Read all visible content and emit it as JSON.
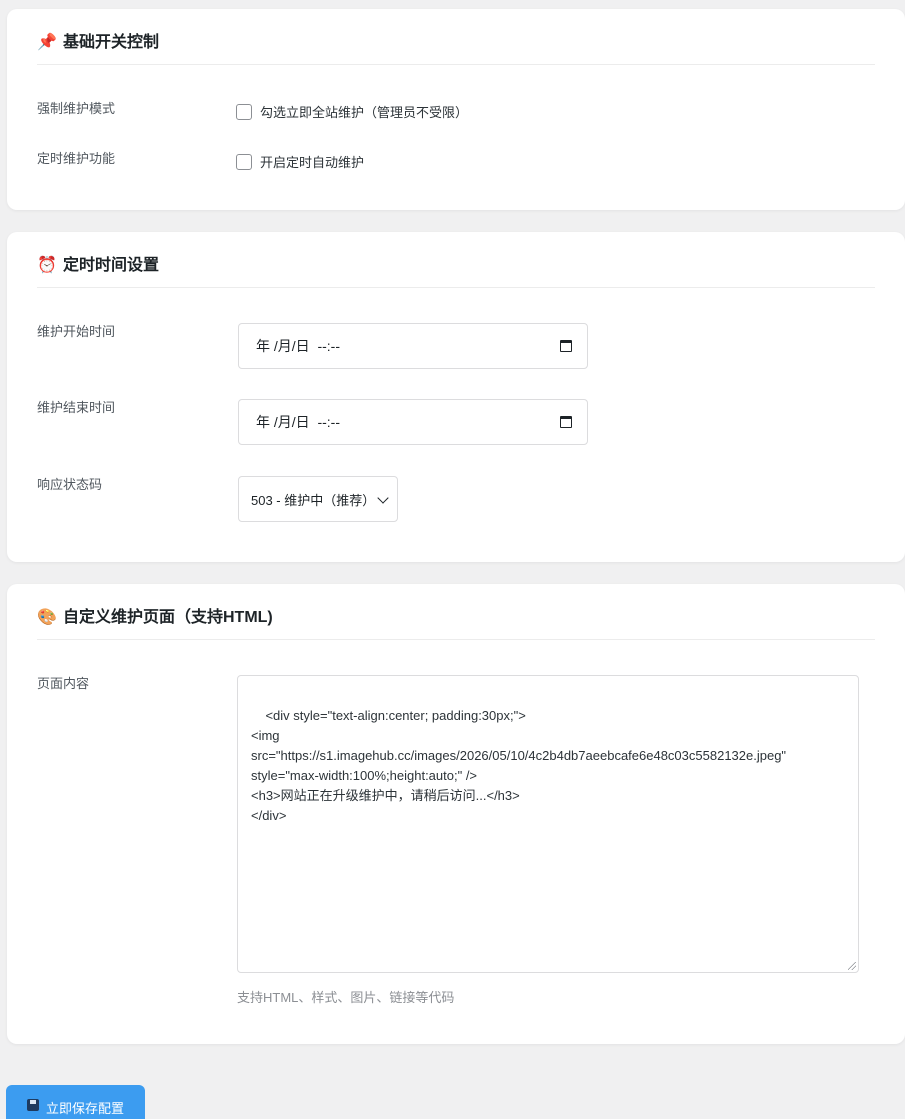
{
  "section_switch": {
    "icon": "pushpin-icon",
    "icon_glyph": "📌",
    "title": "基础开关控制",
    "force_maintenance": {
      "label": "强制维护模式",
      "checkbox_text": "勾选立即全站维护（管理员不受限）",
      "checked": false
    },
    "scheduled_maintenance": {
      "label": "定时维护功能",
      "checkbox_text": "开启定时自动维护",
      "checked": false
    }
  },
  "section_schedule": {
    "icon": "alarm-clock-icon",
    "icon_glyph": "⏰",
    "title": "定时时间设置",
    "start_time": {
      "label": "维护开始时间",
      "value": "年 /月/日  --:--"
    },
    "end_time": {
      "label": "维护结束时间",
      "value": "年 /月/日  --:--"
    },
    "status_code": {
      "label": "响应状态码",
      "selected": "503 - 维护中（推荐）"
    }
  },
  "section_custom": {
    "icon": "palette-icon",
    "icon_glyph": "🎨",
    "title": "自定义维护页面（支持HTML)",
    "content_label": "页面内容",
    "content_value": "<div style=\"text-align:center; padding:30px;\">\n<img\nsrc=\"https://s1.imagehub.cc/images/2026/05/10/4c2b4db7aeebcafe6e48c03c5582132e.jpeg\"\nstyle=\"max-width:100%;height:auto;\" />\n<h3>网站正在升级维护中，请稍后访问...</h3>\n</div>",
    "help_text": "支持HTML、样式、图片、链接等代码"
  },
  "save_button": {
    "icon": "floppy-disk-icon",
    "label": "立即保存配置"
  },
  "colors": {
    "page_bg": "#f0f0f1",
    "card_bg": "#ffffff",
    "button_bg": "#3c9cf0"
  }
}
